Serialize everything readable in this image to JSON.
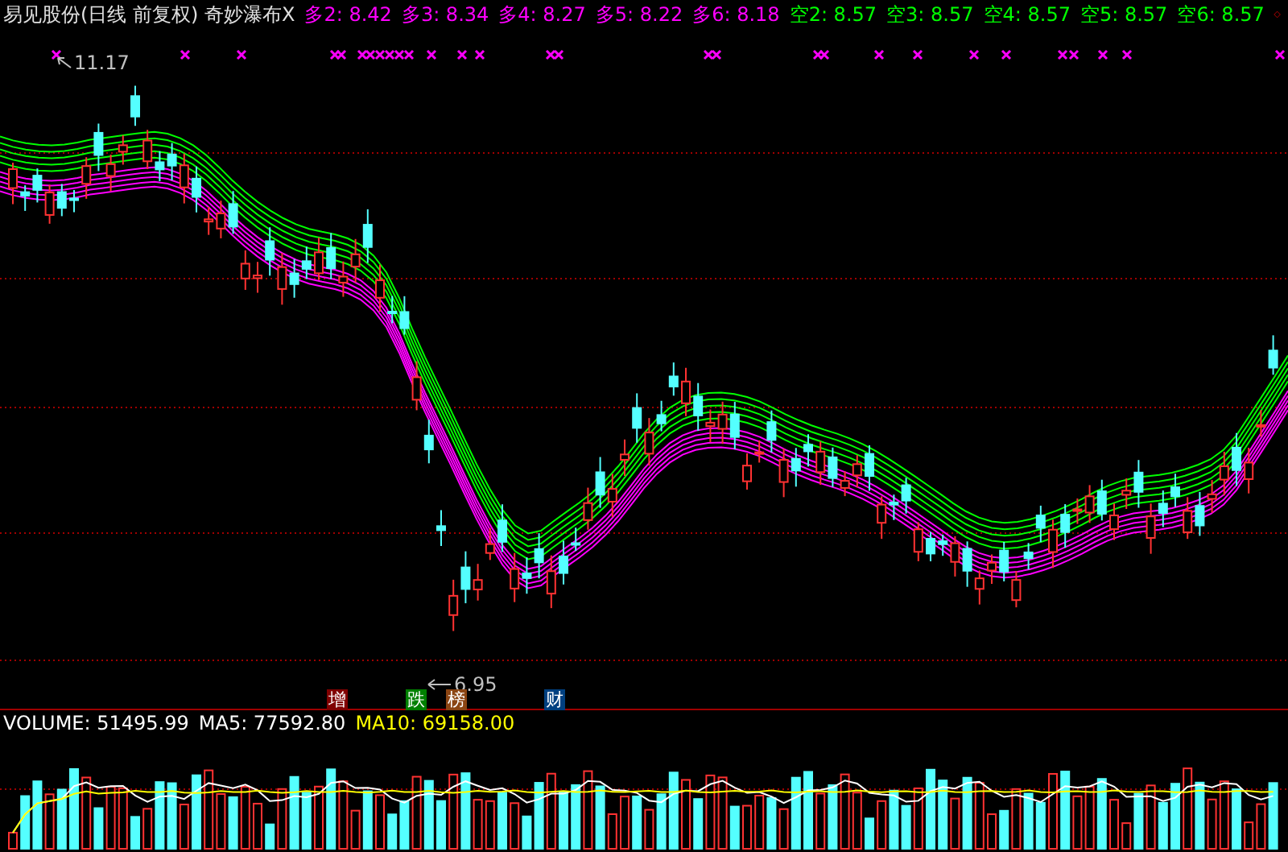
{
  "header": {
    "title": "易见股份(日线 前复权) 奇妙瀑布X",
    "indicators": [
      {
        "label": "多2: 8.42",
        "color": "#ff00ff"
      },
      {
        "label": "多3: 8.34",
        "color": "#ff00ff"
      },
      {
        "label": "多4: 8.27",
        "color": "#ff00ff"
      },
      {
        "label": "多5: 8.22",
        "color": "#ff00ff"
      },
      {
        "label": "多6: 8.18",
        "color": "#ff00ff"
      },
      {
        "label": "空2: 8.57",
        "color": "#00ff00"
      },
      {
        "label": "空3: 8.57",
        "color": "#00ff00"
      },
      {
        "label": "空4: 8.57",
        "color": "#00ff00"
      },
      {
        "label": "空5: 8.57",
        "color": "#00ff00"
      },
      {
        "label": "空6: 8.57",
        "color": "#00ff00"
      }
    ]
  },
  "price_chart": {
    "high_label": "11.17",
    "low_label": "6.95",
    "events": [
      {
        "label": "增",
        "color": "#800000"
      },
      {
        "label": "跌",
        "color": "#008000"
      },
      {
        "label": "榜",
        "color": "#8b4513"
      },
      {
        "label": "财",
        "color": "#004080"
      }
    ]
  },
  "volume_panel": {
    "readings": [
      {
        "label": "VOLUME: 51495.99",
        "color": "#ffffff"
      },
      {
        "label": "MA5: 77592.80",
        "color": "#ffffff"
      },
      {
        "label": "MA10: 69158.00",
        "color": "#ffff00"
      }
    ]
  }
}
